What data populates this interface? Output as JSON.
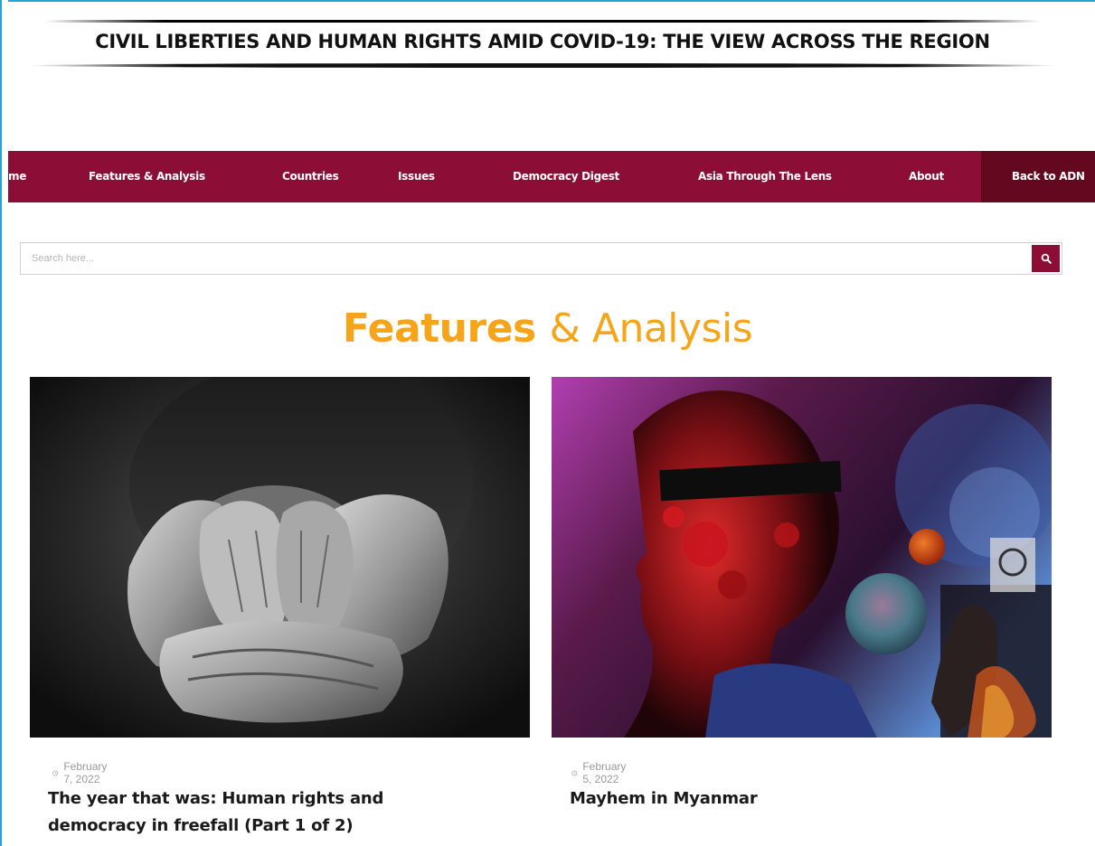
{
  "banner": {
    "title": "CIVIL LIBERTIES AND HUMAN RIGHTS AMID COVID-19: THE VIEW ACROSS  THE REGION"
  },
  "nav": {
    "items": [
      {
        "label": "me"
      },
      {
        "label": "Features & Analysis"
      },
      {
        "label": "Countries"
      },
      {
        "label": "Issues"
      },
      {
        "label": "Democracy Digest"
      },
      {
        "label": "Asia Through The Lens"
      },
      {
        "label": "About"
      },
      {
        "label": "Back to ADN"
      }
    ]
  },
  "search": {
    "placeholder": "Search here...",
    "icon": "search-icon"
  },
  "section": {
    "title_bold": "Features",
    "title_rest": "& Analysis"
  },
  "articles": [
    {
      "date": "February 7, 2022",
      "title": "The year that was: Human rights and democracy in freefall (Part 1 of 2)",
      "image": "hands covering face black and white photo"
    },
    {
      "date": "February 5, 2022",
      "title": "Mayhem in Myanmar",
      "image": "blindfolded man profile collage"
    }
  ],
  "colors": {
    "nav_bg": "#8c0e36",
    "nav_active_bg": "#64081f",
    "accent_orange": "#f6a51a",
    "frame_blue": "#2aa2d6"
  }
}
